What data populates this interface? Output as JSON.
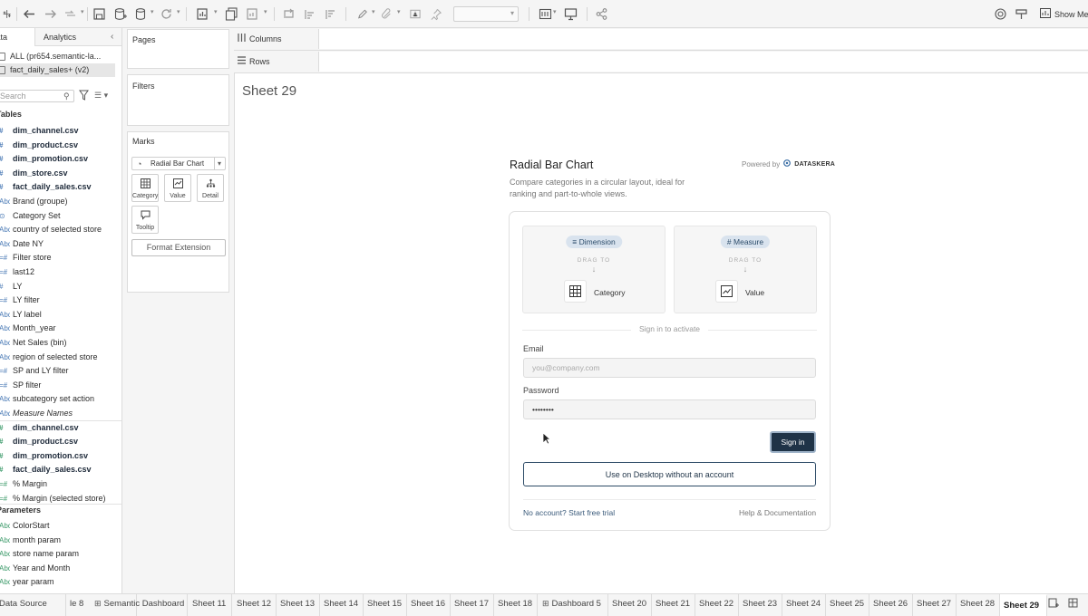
{
  "toolbar": {
    "show_me_label": "Show Me"
  },
  "data_pane": {
    "tabs": {
      "data": "Data",
      "analytics": "Analytics"
    },
    "datasources": [
      {
        "label": "ALL (pr654.semantic-la..."
      },
      {
        "label": "fact_daily_sales+ (v2)"
      }
    ],
    "search_placeholder": "Search",
    "tables_header": "Tables",
    "fields": [
      {
        "label": "dim_channel.csv",
        "icon": "#",
        "style": "bold"
      },
      {
        "label": "dim_product.csv",
        "icon": "#",
        "style": "bold"
      },
      {
        "label": "dim_promotion.csv",
        "icon": "#",
        "style": "bold"
      },
      {
        "label": "dim_store.csv",
        "icon": "#",
        "style": "bold"
      },
      {
        "label": "fact_daily_sales.csv",
        "icon": "#",
        "style": "bold"
      },
      {
        "label": "Brand (groupe)",
        "icon": "Abc",
        "style": ""
      },
      {
        "label": "Category Set",
        "icon": "⊙",
        "style": ""
      },
      {
        "label": "country of selected store",
        "icon": "Abc",
        "style": ""
      },
      {
        "label": "Date NY",
        "icon": "Abc",
        "style": ""
      },
      {
        "label": "Filter store",
        "icon": "=#",
        "style": ""
      },
      {
        "label": "last12",
        "icon": "=#",
        "style": ""
      },
      {
        "label": "LY",
        "icon": "#",
        "style": ""
      },
      {
        "label": "LY filter",
        "icon": "=#",
        "style": ""
      },
      {
        "label": "LY label",
        "icon": "Abc",
        "style": ""
      },
      {
        "label": "Month_year",
        "icon": "Abc",
        "style": ""
      },
      {
        "label": "Net Sales (bin)",
        "icon": "Abc",
        "style": ""
      },
      {
        "label": "region of selected store",
        "icon": "Abc",
        "style": ""
      },
      {
        "label": "SP and LY filter",
        "icon": "=#",
        "style": ""
      },
      {
        "label": "SP filter",
        "icon": "=#",
        "style": ""
      },
      {
        "label": "subcategory set action",
        "icon": "Abc",
        "style": ""
      },
      {
        "label": "Measure Names",
        "icon": "Abc",
        "style": "italic"
      },
      {
        "label": "dim_channel.csv",
        "icon": "#",
        "style": "bold measure"
      },
      {
        "label": "dim_product.csv",
        "icon": "#",
        "style": "bold measure"
      },
      {
        "label": "dim_promotion.csv",
        "icon": "#",
        "style": "bold measure"
      },
      {
        "label": "fact_daily_sales.csv",
        "icon": "#",
        "style": "bold measure"
      },
      {
        "label": "% Margin",
        "icon": "=#",
        "style": "measure"
      },
      {
        "label": "% Margin (selected store)",
        "icon": "=#",
        "style": "measure"
      }
    ],
    "parameters_header": "Parameters",
    "parameters": [
      {
        "label": "ColorStart",
        "icon": "Abc"
      },
      {
        "label": "month param",
        "icon": "Abc"
      },
      {
        "label": "store name param",
        "icon": "Abc"
      },
      {
        "label": "Year and Month",
        "icon": "Abc"
      },
      {
        "label": "year param",
        "icon": "Abc"
      }
    ]
  },
  "cards": {
    "pages": "Pages",
    "filters": "Filters",
    "marks": "Marks",
    "mark_type": "Radial Bar Chart",
    "mark_buttons": [
      {
        "label": "Category",
        "icon": "grid-icon"
      },
      {
        "label": "Value",
        "icon": "line-chart-icon"
      },
      {
        "label": "Detail",
        "icon": "detail-dots-icon"
      },
      {
        "label": "Tooltip",
        "icon": "tooltip-icon"
      }
    ],
    "format_extension": "Format Extension"
  },
  "shelves": {
    "columns": "Columns",
    "rows": "Rows"
  },
  "sheet": {
    "title": "Sheet 29"
  },
  "extension": {
    "title": "Radial Bar Chart",
    "powered_by": "Powered by",
    "brand": "DATASKERA",
    "description": "Compare categories in a circular layout, ideal for ranking and part-to-whole views.",
    "dimension_pill": "Dimension",
    "measure_pill": "Measure",
    "drag_to": "DRAG TO",
    "category_label": "Category",
    "value_label": "Value",
    "signin_hint": "Sign in to activate",
    "email_label": "Email",
    "email_placeholder": "you@company.com",
    "password_label": "Password",
    "password_value": "••••••••",
    "signin_button": "Sign in",
    "desktop_button": "Use on Desktop without an account",
    "no_account_link": "No account? Start free trial",
    "help_link": "Help & Documentation"
  },
  "tabs": [
    {
      "label": "Data Source",
      "icon": ""
    },
    {
      "label": "le 8",
      "icon": ""
    },
    {
      "label": "Semantic Dashboard",
      "icon": "⊞"
    },
    {
      "label": "Sheet 11",
      "icon": ""
    },
    {
      "label": "Sheet 12",
      "icon": ""
    },
    {
      "label": "Sheet 13",
      "icon": ""
    },
    {
      "label": "Sheet 14",
      "icon": ""
    },
    {
      "label": "Sheet 15",
      "icon": ""
    },
    {
      "label": "Sheet 16",
      "icon": ""
    },
    {
      "label": "Sheet 17",
      "icon": ""
    },
    {
      "label": "Sheet 18",
      "icon": ""
    },
    {
      "label": "Dashboard 5",
      "icon": "⊞"
    },
    {
      "label": "Sheet 20",
      "icon": ""
    },
    {
      "label": "Sheet 21",
      "icon": ""
    },
    {
      "label": "Sheet 22",
      "icon": ""
    },
    {
      "label": "Sheet 23",
      "icon": ""
    },
    {
      "label": "Sheet 24",
      "icon": ""
    },
    {
      "label": "Sheet 25",
      "icon": ""
    },
    {
      "label": "Sheet 26",
      "icon": ""
    },
    {
      "label": "Sheet 27",
      "icon": ""
    },
    {
      "label": "Sheet 28",
      "icon": ""
    },
    {
      "label": "Sheet 29",
      "icon": "",
      "active": true
    }
  ]
}
